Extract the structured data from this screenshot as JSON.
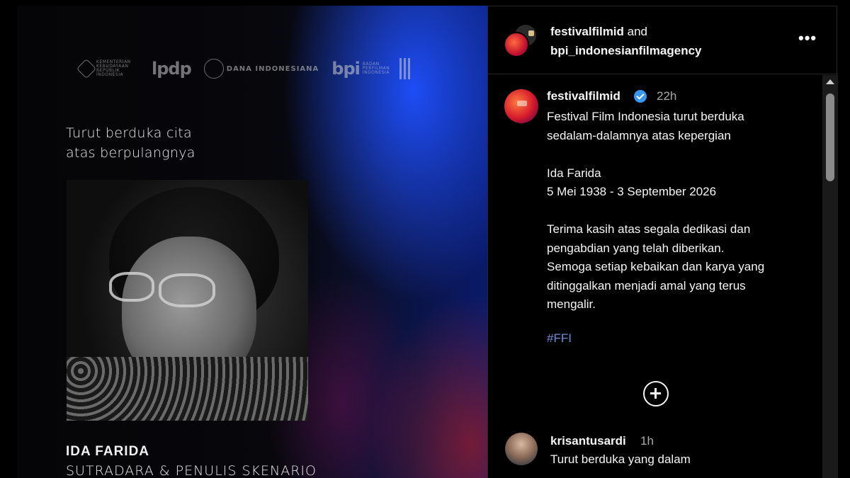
{
  "post_image": {
    "logos": {
      "kemen_text": "KEMENTERIAN KEBUDAYAAN REPUBLIK INDONESIA",
      "lpdp": "lpdp",
      "dana": "DANA INDONESIANA",
      "bpi": "bpi",
      "bpi_small": "BADAN PERFILMAN INDONESIA"
    },
    "caption_line1": "Turut berduka cita",
    "caption_line2": "atas berpulangnya",
    "name": "IDA FARIDA",
    "role": "SUTRADARA & PENULIS SKENARIO"
  },
  "header": {
    "user1": "festivalfilmid",
    "joiner": " and",
    "user2": "bpi_indonesianfilmagency",
    "more_label": "•••"
  },
  "caption": {
    "username": "festivalfilmid",
    "time": "22h",
    "paragraph1": "Festival Film Indonesia turut berduka\nsedalam-dalamnya atas kepergian",
    "paragraph2": "Ida Farida\n5 Mei 1938 - 3 September 2026",
    "paragraph3": "Terima kasih atas segala dedikasi dan\npengabdian yang telah diberikan.\nSemoga setiap kebaikan dan karya yang\nditinggalkan menjadi amal yang terus\nmengalir.",
    "hashtag": "#FFI"
  },
  "comment": {
    "username": "krisantusardi",
    "time": "1h",
    "text": "Turut berduka yang dalam"
  },
  "colors": {
    "hashtag": "#6f8bd8",
    "verified": "#3897f0",
    "muted": "#a8a8a8"
  }
}
